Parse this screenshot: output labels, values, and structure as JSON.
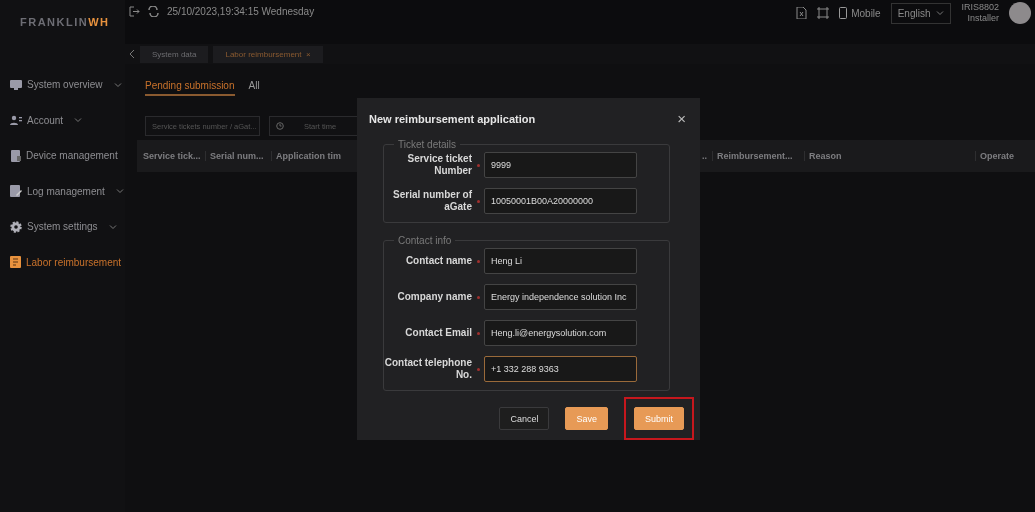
{
  "logo": "FRANKLIN**WH**",
  "sidebar": {
    "items": [
      {
        "kind": "monitor",
        "label": "System overview",
        "expandable": true,
        "selected": false
      },
      {
        "kind": "users",
        "label": "Account",
        "expandable": true,
        "selected": false
      },
      {
        "kind": "device",
        "label": "Device management",
        "expandable": false,
        "selected": false
      },
      {
        "kind": "log",
        "label": "Log management",
        "expandable": true,
        "selected": false
      },
      {
        "kind": "gear",
        "label": "System settings",
        "expandable": true,
        "selected": false
      },
      {
        "kind": "receipt",
        "label": "Labor reimbursement",
        "expandable": false,
        "selected": true
      }
    ]
  },
  "header": {
    "datetime": "25/10/2023,19:34:15 Wednesday",
    "mobile_label": "Mobile",
    "language": "English",
    "user": {
      "name": "IRIS8802",
      "role": "Installer"
    }
  },
  "page_tabs": [
    {
      "label": "System data",
      "selected": false
    },
    {
      "label": "Labor reimbursement",
      "selected": true,
      "close": "×"
    }
  ],
  "filter_tabs": [
    {
      "label": "Pending submission",
      "selected": true
    },
    {
      "label": "All",
      "selected": false
    }
  ],
  "search": {
    "placeholder": "Service tickets number / aGat..."
  },
  "time_field": {
    "placeholder": "Start time"
  },
  "table": {
    "columns": [
      "Service tick...",
      "Serial num...",
      "Application tim",
      "..",
      "Reimbursement...",
      "Reason",
      "Operate"
    ]
  },
  "dialog": {
    "title": "New reimbursement application",
    "close": "×",
    "sections": [
      {
        "legend": "Ticket details",
        "fields": [
          {
            "label": "Service ticket Number",
            "value": "9999",
            "required": true,
            "focused": false
          },
          {
            "label": "Serial number of aGate",
            "value": "10050001B00A20000000",
            "required": true,
            "focused": false
          }
        ]
      },
      {
        "legend": "Contact info",
        "fields": [
          {
            "label": "Contact name",
            "value": "Heng Li",
            "required": true,
            "focused": false
          },
          {
            "label": "Company name",
            "value": "Energy independence solution Inc",
            "required": true,
            "focused": false
          },
          {
            "label": "Contact Email",
            "value": "Heng.li@energysolution.com",
            "required": true,
            "focused": false
          },
          {
            "label": "Contact telephone No.",
            "value": "+1 332 288 9363",
            "required": true,
            "focused": true
          }
        ]
      }
    ],
    "buttons": [
      {
        "kind": "secondary",
        "label": "Cancel",
        "highlighted": false
      },
      {
        "kind": "primary",
        "label": "Save",
        "highlighted": false
      },
      {
        "kind": "primary",
        "label": "Submit",
        "highlighted": true
      }
    ]
  }
}
